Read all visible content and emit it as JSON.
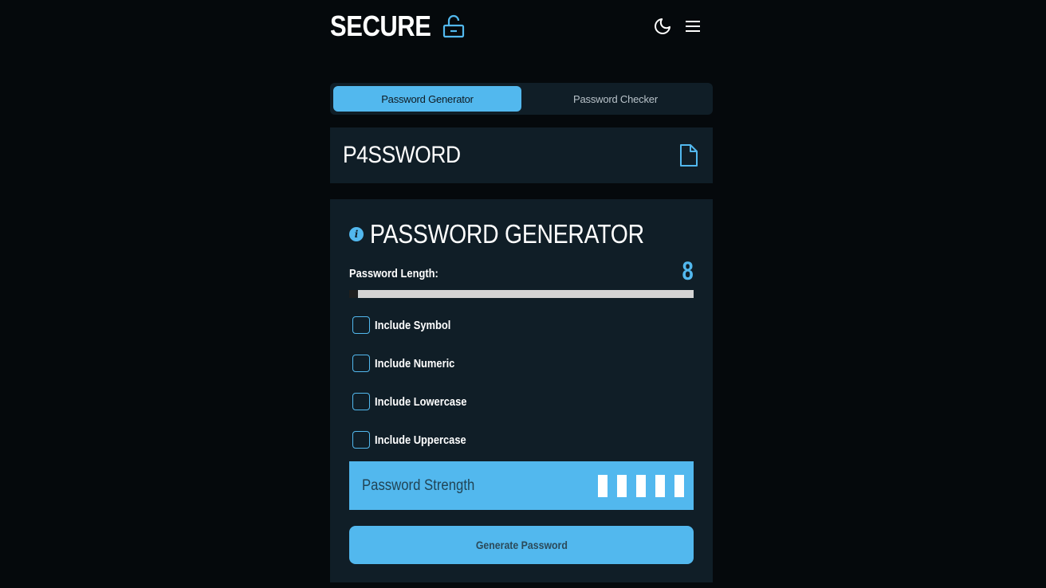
{
  "brand": {
    "title": "SECURE",
    "lock_icon": "unlocked-padlock-icon"
  },
  "header": {
    "theme_icon": "moon-icon",
    "menu_icon": "hamburger-menu-icon"
  },
  "tabs": [
    {
      "label": "Password Generator",
      "active": true
    },
    {
      "label": "Password Checker",
      "active": false
    }
  ],
  "output": {
    "password": "P4SSWORD",
    "copy_icon": "document-copy-icon"
  },
  "generator": {
    "title": "PASSWORD GENERATOR",
    "info_icon": "info-icon",
    "length_label": "Password Length:",
    "length_value": "8",
    "slider_fraction": 0.0,
    "options": [
      {
        "label": "Include Symbol",
        "checked": false
      },
      {
        "label": "Include Numeric",
        "checked": false
      },
      {
        "label": "Include Lowercase",
        "checked": false
      },
      {
        "label": "Include Uppercase",
        "checked": false
      }
    ],
    "strength_label": "Password Strength",
    "strength_bars_total": 5,
    "button_label": "Generate Password"
  },
  "colors": {
    "accent": "#52b8ee",
    "panel": "#101e27",
    "background": "#05090c"
  }
}
